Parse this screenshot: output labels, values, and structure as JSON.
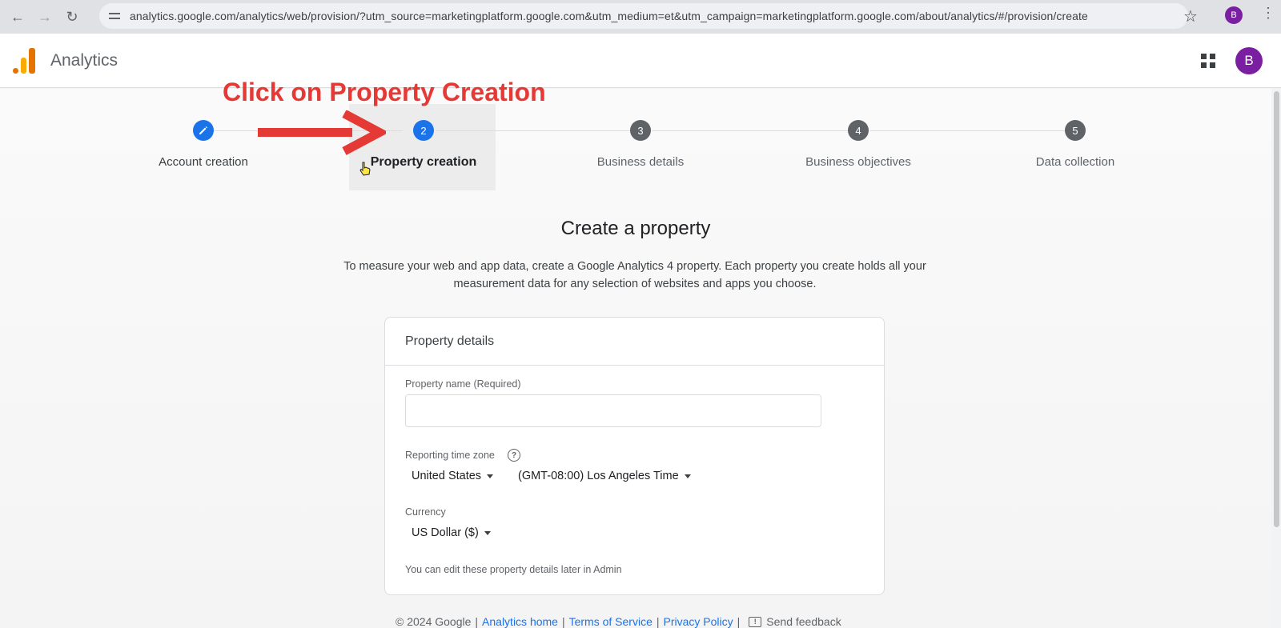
{
  "browser": {
    "back_icon": "arrow-left-icon",
    "forward_icon": "arrow-right-icon",
    "reload_icon": "reload-icon",
    "url": "analytics.google.com/analytics/web/provision/?utm_source=marketingplatform.google.com&utm_medium=et&utm_campaign=marketingplatform.google.com/about/analytics/#/provision/create",
    "profile_initial": "B"
  },
  "app": {
    "title": "Analytics",
    "avatar_initial": "B"
  },
  "annotation": {
    "text": "Click on Property Creation",
    "color": "#e53935"
  },
  "stepper": {
    "steps": [
      {
        "number": "",
        "label": "Account creation",
        "state": "done"
      },
      {
        "number": "2",
        "label": "Property creation",
        "state": "active"
      },
      {
        "number": "3",
        "label": "Business details",
        "state": "todo"
      },
      {
        "number": "4",
        "label": "Business objectives",
        "state": "todo"
      },
      {
        "number": "5",
        "label": "Data collection",
        "state": "todo"
      }
    ]
  },
  "main": {
    "heading": "Create a property",
    "description": "To measure your web and app data, create a Google Analytics 4 property. Each property you create holds all your measurement data for any selection of websites and apps you choose."
  },
  "card": {
    "title": "Property details",
    "property_name_label": "Property name (Required)",
    "property_name_value": "",
    "timezone_label": "Reporting time zone",
    "help_glyph": "?",
    "country": "United States",
    "timezone": "(GMT-08:00) Los Angeles Time",
    "currency_label": "Currency",
    "currency": "US Dollar ($)",
    "note": "You can edit these property details later in Admin"
  },
  "footer": {
    "copyright": "© 2024 Google",
    "sep": "|",
    "links": [
      "Analytics home",
      "Terms of Service",
      "Privacy Policy"
    ],
    "feedback": "Send feedback"
  },
  "colors": {
    "accent": "#1a73e8",
    "step_inactive": "#5f6368",
    "avatar": "#7b1fa2",
    "logo_orange": "#e37400",
    "logo_yellow": "#f9ab00"
  }
}
